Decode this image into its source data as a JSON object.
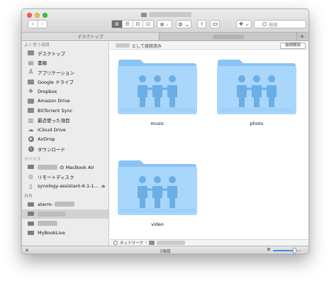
{
  "window": {
    "search_placeholder": "検索"
  },
  "toolbar": {
    "back_glyph": "‹",
    "forward_glyph": "›",
    "view_icon_glyph": "⊞",
    "view_list_glyph": "☰",
    "view_column_glyph": "⊟",
    "view_cover_glyph": "⊡",
    "arrange_glyph": "▦ ⌄",
    "action_glyph": "⚙ ⌄",
    "share_glyph": "⇧",
    "dropbox_glyph": "❖ ⌄"
  },
  "tabs": {
    "first": "デスクトップ",
    "plus": "+"
  },
  "sidebar": {
    "favorites_header": "よく使う項目",
    "favorites": [
      {
        "label": "デスクトップ",
        "icon": "desktop-folder-icon"
      },
      {
        "label": "書類",
        "icon": "documents-icon"
      },
      {
        "label": "アプリケーション",
        "icon": "applications-icon"
      },
      {
        "label": "Google ドライブ",
        "icon": "folder-icon"
      },
      {
        "label": "Dropbox",
        "icon": "dropbox-icon"
      },
      {
        "label": "Amazon Drive",
        "icon": "folder-icon"
      },
      {
        "label": "BitTorrent Sync",
        "icon": "folder-icon"
      },
      {
        "label": "最近使った項目",
        "icon": "recents-icon"
      },
      {
        "label": "iCloud Drive",
        "icon": "cloud-icon"
      },
      {
        "label": "AirDrop",
        "icon": "airdrop-icon"
      },
      {
        "label": "ダウンロード",
        "icon": "downloads-icon"
      }
    ],
    "devices_header": "デバイス",
    "devices": [
      {
        "label": "の MacBook Air",
        "icon": "laptop-icon"
      },
      {
        "label": "リモートディスク",
        "icon": "disc-icon"
      },
      {
        "label": "synology-assistant-6.1-1...",
        "icon": "disk-image-icon",
        "eject": "⏏"
      }
    ],
    "shared_header": "共有",
    "shared": [
      {
        "label": "aterm-",
        "icon": "server-icon"
      },
      {
        "label": "",
        "icon": "server-icon"
      },
      {
        "label": "",
        "icon": "server-icon"
      },
      {
        "label": "MyBookLive",
        "icon": "server-icon"
      }
    ]
  },
  "content": {
    "connection_text": "として接続済み",
    "disconnect_label": "接続解除",
    "folders": [
      {
        "name": "music"
      },
      {
        "name": "photo"
      },
      {
        "name": "video"
      }
    ]
  },
  "pathbar": {
    "network_label": "ネットワーク",
    "separator": "›"
  },
  "statusbar": {
    "item_count": "3項目",
    "tool_glyph": "✕",
    "icon_size_level": 0.75
  },
  "colors": {
    "folder_back": "#89c3f4",
    "folder_front": "#a9d6fb",
    "sidebar_bg": "#ececec",
    "accent": "#3c8cf0"
  }
}
